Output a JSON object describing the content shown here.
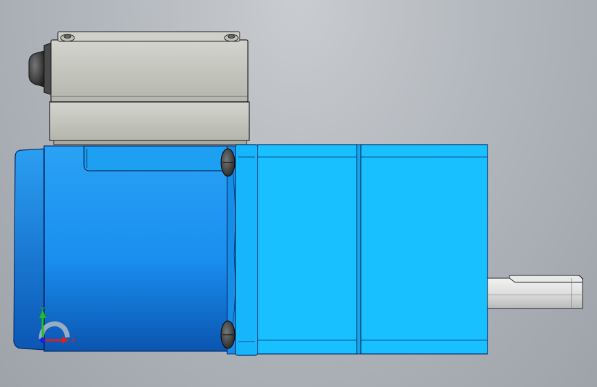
{
  "viewport": {
    "background_top": "#c9ccd0",
    "background_bottom": "#9ea3aa"
  },
  "model": {
    "motor_color": "#1aa6f0",
    "gearbox_color": "#19c0ff",
    "terminal_box_color": "#c2c4bc",
    "shaft_color": "#dcdcdc"
  },
  "triad": {
    "x_label": "X",
    "y_label": "Y",
    "x_color": "#e02020",
    "y_color": "#20c020",
    "z_color": "#2020e0"
  }
}
